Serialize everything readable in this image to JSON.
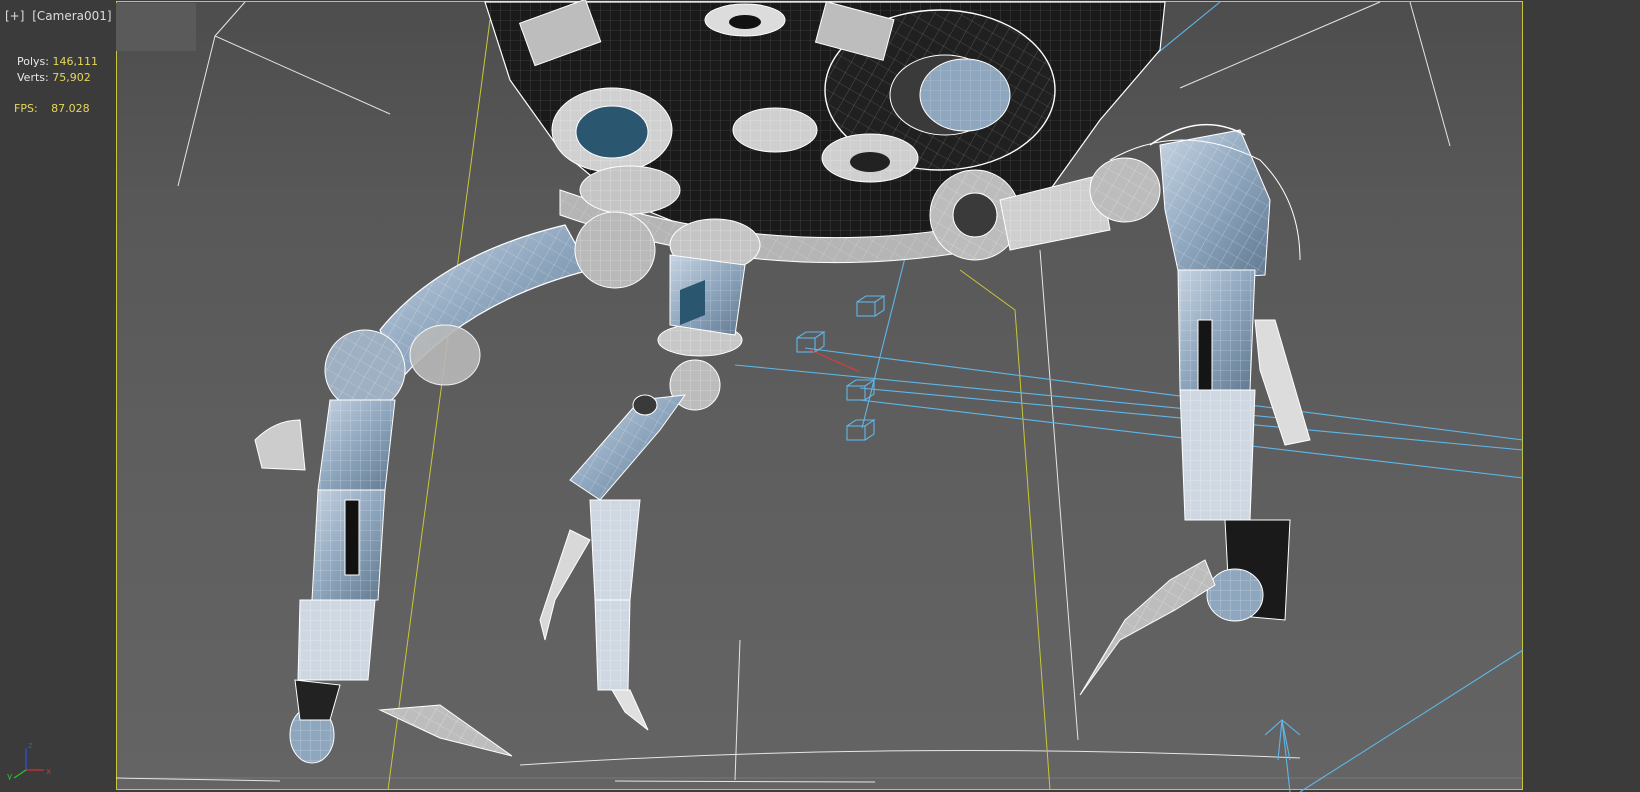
{
  "viewport": {
    "menu_button": "[+]",
    "camera_label": "[Camera001]"
  },
  "stats": {
    "polys_label": "Polys:",
    "polys_value": "146,111",
    "verts_label": "Verts:",
    "verts_value": "75,902",
    "fps_label": "FPS:",
    "fps_value": "87.028"
  },
  "axis_gizmo": {
    "x_label": "x",
    "y_label": "y",
    "z_label": "z"
  },
  "colors": {
    "safe_frame": "#c9c63a",
    "wireframe": "#ffffff",
    "shaded_metal": "#8fa7bf",
    "helper_blue": "#5fb6e8",
    "stat_value": "#e3d85a",
    "axis_x": "#d03030",
    "axis_y": "#30c030",
    "axis_z": "#3050e0"
  }
}
